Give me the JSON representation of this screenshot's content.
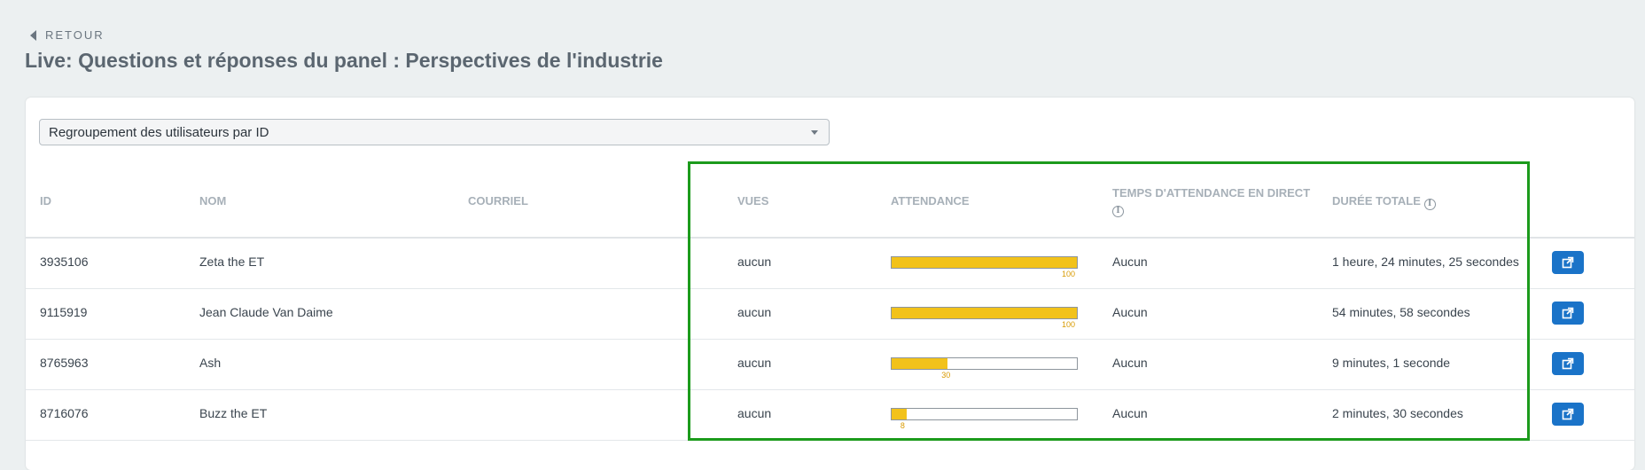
{
  "nav": {
    "back_label": "RETOUR"
  },
  "page": {
    "title": "Live: Questions et réponses du panel : Perspectives de l'industrie"
  },
  "grouping": {
    "selected": "Regroupement des utilisateurs par ID"
  },
  "columns": {
    "id": "ID",
    "nom": "NOM",
    "courriel": "COURRIEL",
    "vues": "VUES",
    "attendance": "ATTENDANCE",
    "temps_direct": "TEMPS D'ATTENDANCE EN DIRECT",
    "duree_totale": "DURÉE TOTALE"
  },
  "rows": [
    {
      "id": "3935106",
      "nom": "Zeta the ET",
      "courriel": "",
      "vues": "aucun",
      "attendance": 100,
      "attendance_label": "100",
      "temps_direct": "Aucun",
      "duree_totale": "1 heure, 24 minutes, 25 secondes"
    },
    {
      "id": "9115919",
      "nom": "Jean Claude Van Daime",
      "courriel": "",
      "vues": "aucun",
      "attendance": 100,
      "attendance_label": "100",
      "temps_direct": "Aucun",
      "duree_totale": "54 minutes, 58 secondes"
    },
    {
      "id": "8765963",
      "nom": "Ash",
      "courriel": "",
      "vues": "aucun",
      "attendance": 30,
      "attendance_label": "30",
      "temps_direct": "Aucun",
      "duree_totale": "9 minutes, 1 seconde"
    },
    {
      "id": "8716076",
      "nom": "Buzz the ET",
      "courriel": "",
      "vues": "aucun",
      "attendance": 8,
      "attendance_label": "8",
      "temps_direct": "Aucun",
      "duree_totale": "2 minutes, 30 secondes"
    }
  ],
  "colors": {
    "highlight_border": "#1c9b1c",
    "attendance_fill": "#f2c21a",
    "action_button": "#1a73c8"
  },
  "icons": {
    "back": "caret-left-icon",
    "info": "info-circle-icon",
    "action": "external-link-icon",
    "dropdown": "chevron-down-icon"
  }
}
